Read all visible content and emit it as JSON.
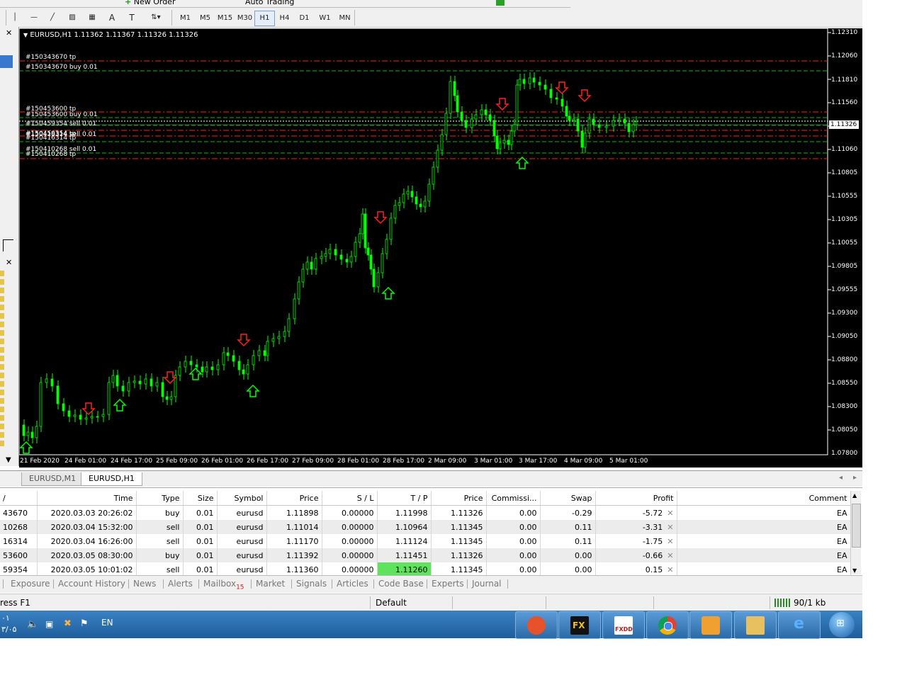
{
  "toolbar": {
    "new_order": "New Order",
    "auto_trading": "Auto Trading",
    "timeframes": [
      "M1",
      "M5",
      "M15",
      "M30",
      "H1",
      "H4",
      "D1",
      "W1",
      "MN"
    ],
    "active_timeframe": "H1"
  },
  "chart": {
    "title": "EURUSD,H1  1.11362 1.11367 1.11326 1.11326",
    "current_price": "1.11326",
    "price_labels": [
      "1.12310",
      "1.12060",
      "1.11810",
      "1.11560",
      "1.11326",
      "1.11060",
      "1.10805",
      "1.10555",
      "1.10305",
      "1.10055",
      "1.09805",
      "1.09555",
      "1.09300",
      "1.09050",
      "1.08800",
      "1.08550",
      "1.08300",
      "1.08050",
      "1.07800"
    ],
    "time_labels": [
      "21 Feb 2020",
      "24 Feb 01:00",
      "24 Feb 17:00",
      "25 Feb 09:00",
      "26 Feb 01:00",
      "26 Feb 17:00",
      "27 Feb 09:00",
      "28 Feb 01:00",
      "28 Feb 17:00",
      "2 Mar 09:00",
      "3 Mar 01:00",
      "3 Mar 17:00",
      "4 Mar 09:00",
      "5 Mar 01:00"
    ],
    "order_labels": [
      "#150343670 tp",
      "#150343670 buy 0.01",
      "#150453600 tp",
      "#150453600 buy 0.01",
      "#150459354 sell 0.01",
      "#150459354 tp",
      "#150416314 sell 0.01",
      "#150416314 tp",
      "#150410268 sell 0.01",
      "#150410268 tp"
    ],
    "bull_color": "#00ff00",
    "sell_arrow_color": "#ff2020",
    "buy_arrow_color": "#00ff00"
  },
  "chart_tabs": [
    "EURUSD,M1",
    "EURUSD,H1"
  ],
  "trade_table": {
    "columns": [
      "/",
      "Time",
      "Type",
      "Size",
      "Symbol",
      "Price",
      "S / L",
      "T / P",
      "Price",
      "Commissi...",
      "Swap",
      "Profit",
      "Comment"
    ],
    "rows": [
      {
        "order": "43670",
        "time": "2020.03.03 20:26:02",
        "type": "buy",
        "size": "0.01",
        "symbol": "eurusd",
        "price": "1.11898",
        "sl": "0.00000",
        "tp": "1.11998",
        "cur": "1.11326",
        "comm": "0.00",
        "swap": "-0.29",
        "profit": "-5.72",
        "comment": "EA"
      },
      {
        "order": "10268",
        "time": "2020.03.04 15:32:00",
        "type": "sell",
        "size": "0.01",
        "symbol": "eurusd",
        "price": "1.11014",
        "sl": "0.00000",
        "tp": "1.10964",
        "cur": "1.11345",
        "comm": "0.00",
        "swap": "0.11",
        "profit": "-3.31",
        "comment": "EA"
      },
      {
        "order": "16314",
        "time": "2020.03.04 16:26:00",
        "type": "sell",
        "size": "0.01",
        "symbol": "eurusd",
        "price": "1.11170",
        "sl": "0.00000",
        "tp": "1.11124",
        "cur": "1.11345",
        "comm": "0.00",
        "swap": "0.11",
        "profit": "-1.75",
        "comment": "EA"
      },
      {
        "order": "53600",
        "time": "2020.03.05 08:30:00",
        "type": "buy",
        "size": "0.01",
        "symbol": "eurusd",
        "price": "1.11392",
        "sl": "0.00000",
        "tp": "1.11451",
        "cur": "1.11326",
        "comm": "0.00",
        "swap": "0.00",
        "profit": "-0.66",
        "comment": "EA"
      },
      {
        "order": "59354",
        "time": "2020.03.05 10:01:02",
        "type": "sell",
        "size": "0.01",
        "symbol": "eurusd",
        "price": "1.11360",
        "sl": "0.00000",
        "tp": "1.11260",
        "cur": "1.11345",
        "comm": "0.00",
        "swap": "0.00",
        "profit": "0.15",
        "comment": "EA"
      }
    ]
  },
  "bottom_tabs": [
    "Exposure",
    "Account History",
    "News",
    "Alerts",
    "Mailbox",
    "Market",
    "Signals",
    "Articles",
    "Code Base",
    "Experts",
    "Journal"
  ],
  "mailbox_count": "15",
  "status": {
    "help": "ress F1",
    "profile": "Default",
    "traffic": "90/1 kb"
  },
  "taskbar": {
    "lang": "EN",
    "clock_line1": "۰۱",
    "clock_line2": "۳/۰۵"
  }
}
